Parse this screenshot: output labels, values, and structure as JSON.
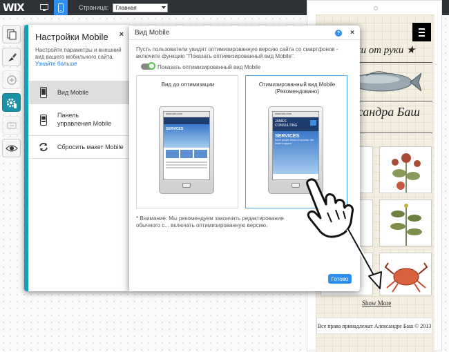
{
  "topbar": {
    "logo": "WIX",
    "page_label": "Страница:",
    "page_value": "Главная"
  },
  "site": {
    "title1": "нки от руки ★",
    "title2": "ксандра Баш",
    "show_more": "Show More",
    "footer": "Все права принадлежат Александре Баш © 2013"
  },
  "panel": {
    "title": "Настройки Mobile",
    "close": "×",
    "description": "Настройте параметры и внешний вид вашего мобильного сайта.",
    "link": "Узнайте больше",
    "items": [
      {
        "label": "Вид Mobile",
        "icon": "phone-icon"
      },
      {
        "label": "Панель управления Mobile",
        "icon": "phone-panel-icon"
      },
      {
        "label": "Сбросить макет Mobile",
        "icon": "refresh-icon"
      }
    ]
  },
  "dialog": {
    "title": "Вид Mobile",
    "help": "?",
    "close": "×",
    "description": "Пусть пользователи увидят оптимизированную версию сайта со смартфонов - включите функцию \"Показать оптимизированный вид Mobile\".",
    "toggle_label": "Показать оптимизированный вид Mobile",
    "toggle_on": true,
    "option_before": "Вид до оптимизации",
    "option_after": "Отимизированный вид Mobile (Рекомендовано)",
    "note": "* Внимание: Мы рекомендуем закончить редактирование обычного с... включать оптимизированную версию.",
    "done": "Готово",
    "tablet_url": "www.wix.com",
    "tablet_services": "SERVICES",
    "tablet_brand1": "JAMES",
    "tablet_brand2": "CONSULTING",
    "tablet_services_sub": "Some people dream of success. We make it happen."
  },
  "colors": {
    "accent": "#13a1ba",
    "primary_button": "#2d8ef0",
    "topbar": "#2f3337"
  }
}
